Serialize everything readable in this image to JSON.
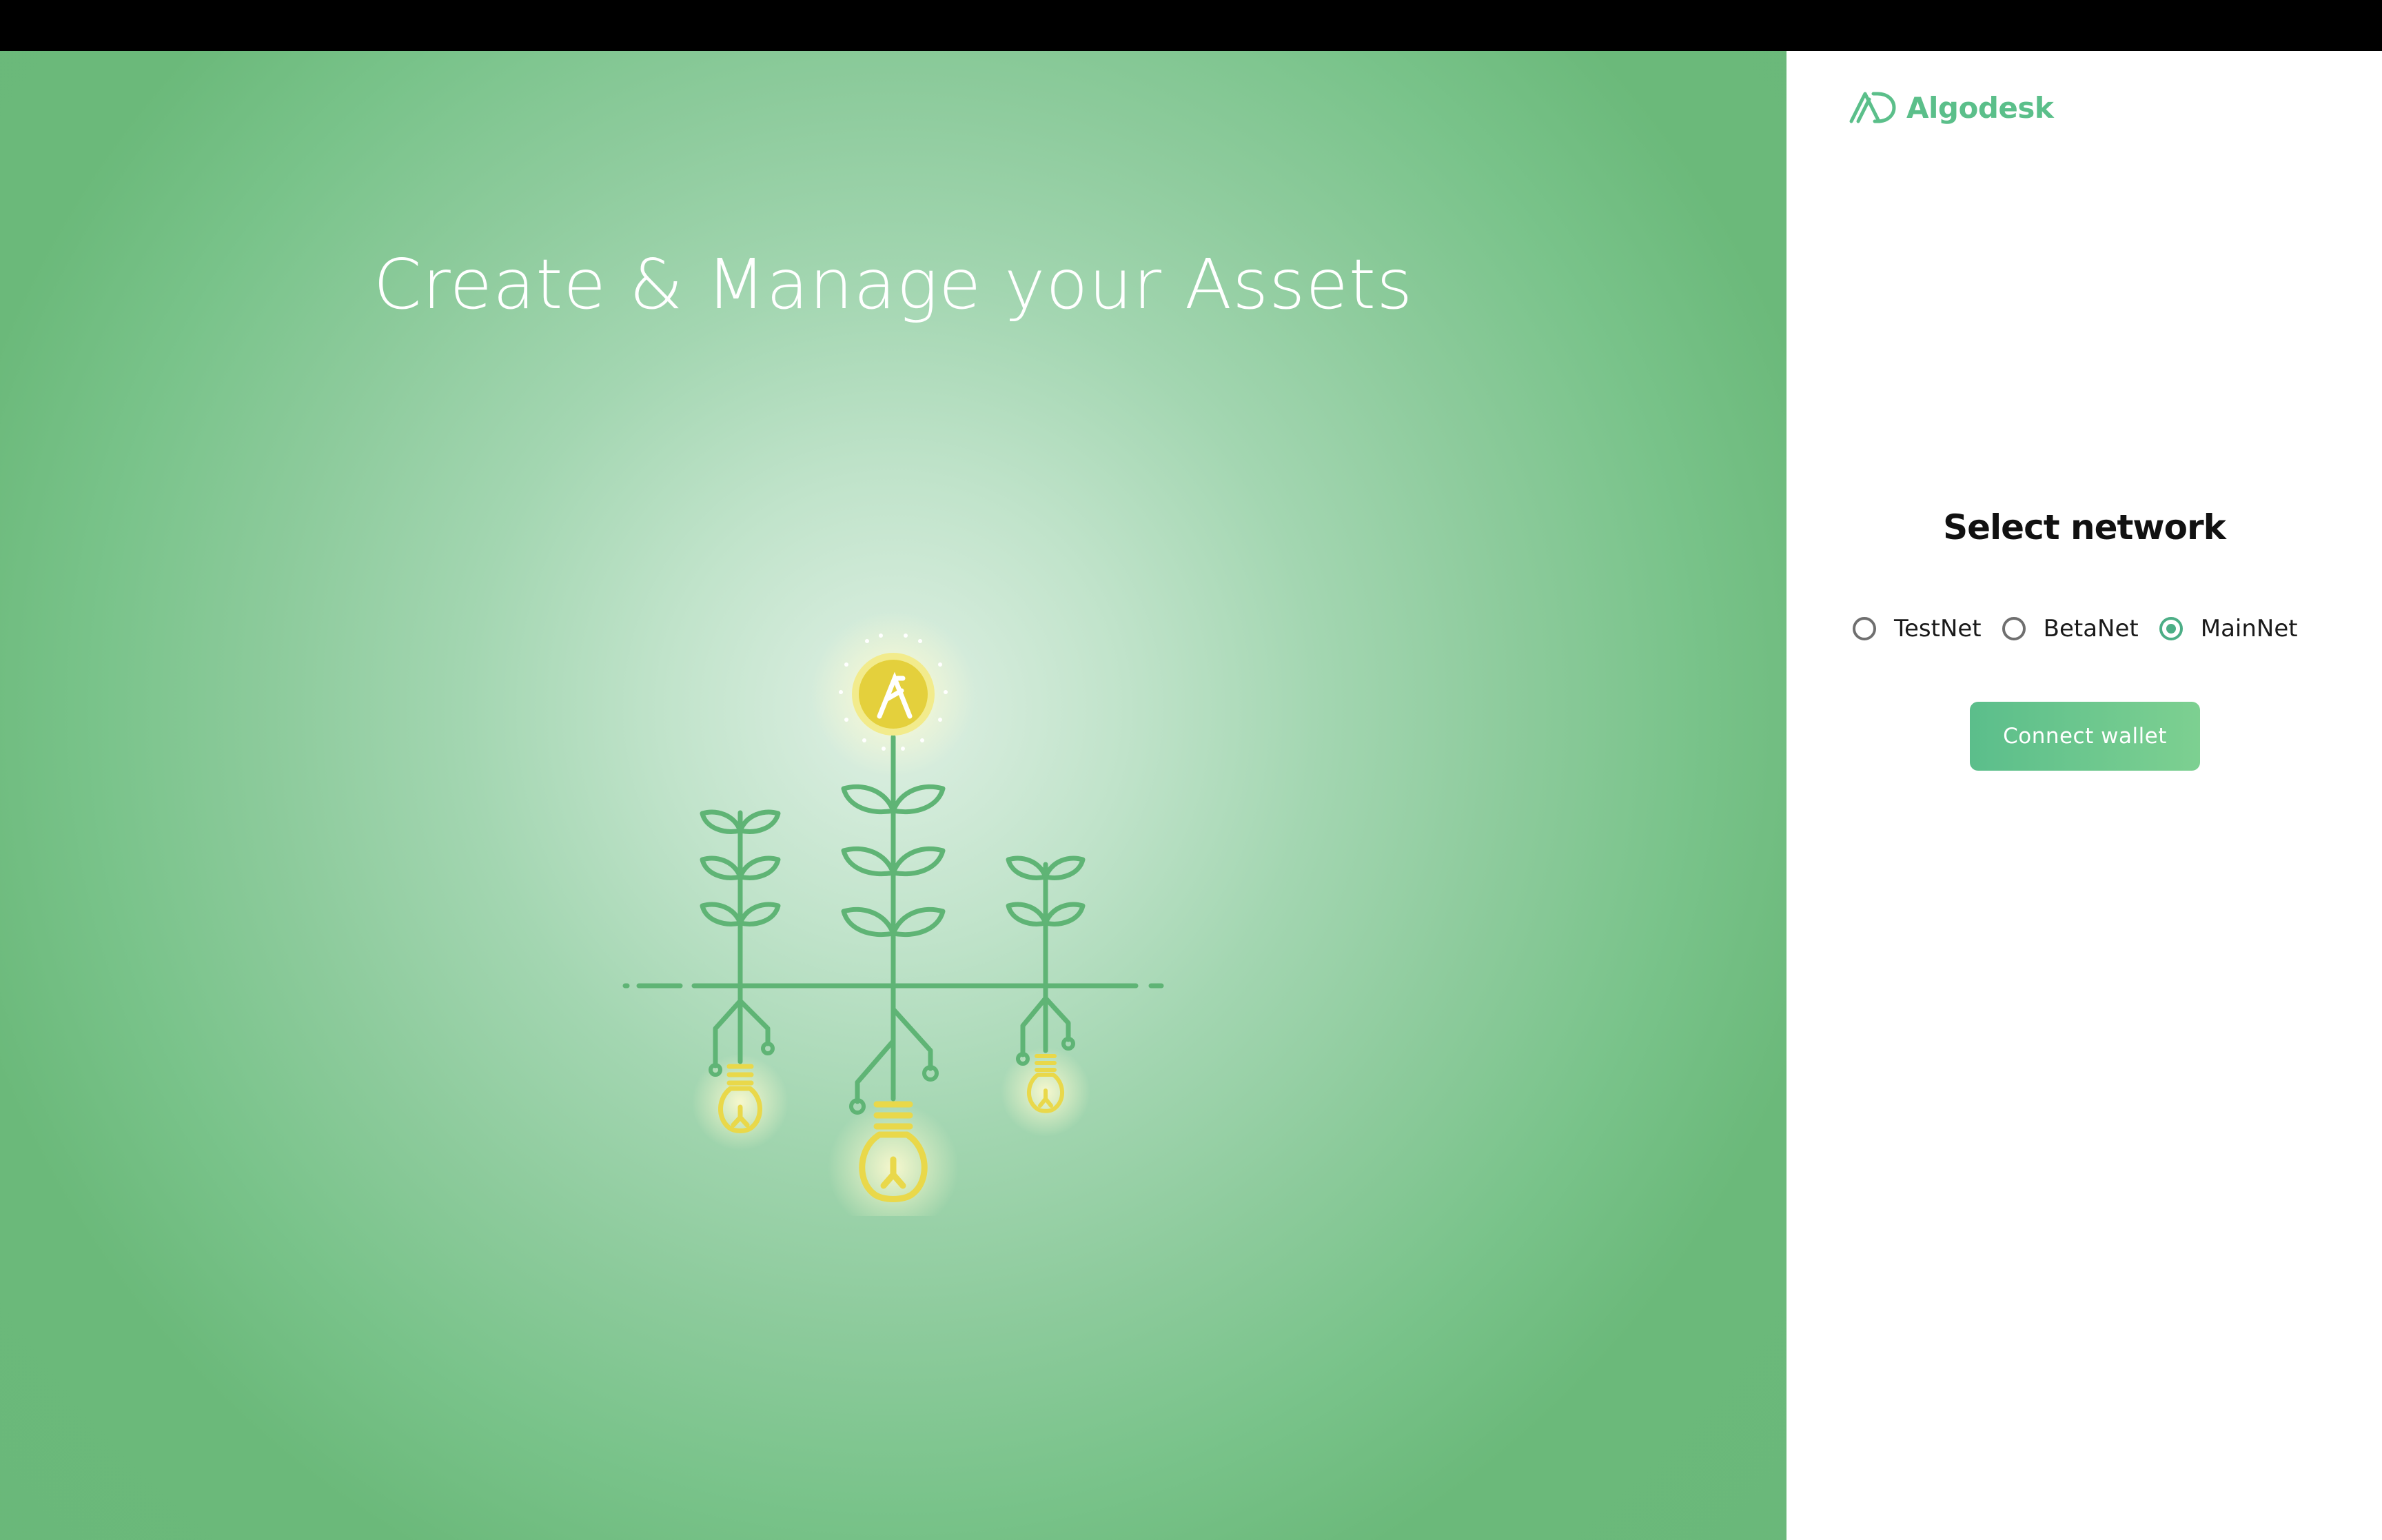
{
  "hero": {
    "title": "Create & Manage your Assets",
    "illustration_icon": "algorand-plant-lightbulb-illustration"
  },
  "brand": {
    "name": "Algodesk",
    "logo_icon": "algodesk-logo-icon"
  },
  "network_selector": {
    "title": "Select network",
    "options": [
      {
        "label": "TestNet",
        "selected": false
      },
      {
        "label": "BetaNet",
        "selected": false
      },
      {
        "label": "MainNet",
        "selected": true
      }
    ]
  },
  "actions": {
    "connect_label": "Connect wallet"
  },
  "colors": {
    "hero_green": "#6ab879",
    "hero_center": "#dff0e4",
    "brand_green": "#5bbf8a",
    "radio_selected": "#4cae86",
    "button_gradient_start": "#5bbe8b",
    "button_gradient_end": "#7dd091",
    "stem_green": "#5fb475",
    "bulb_yellow": "#e9d84a"
  }
}
